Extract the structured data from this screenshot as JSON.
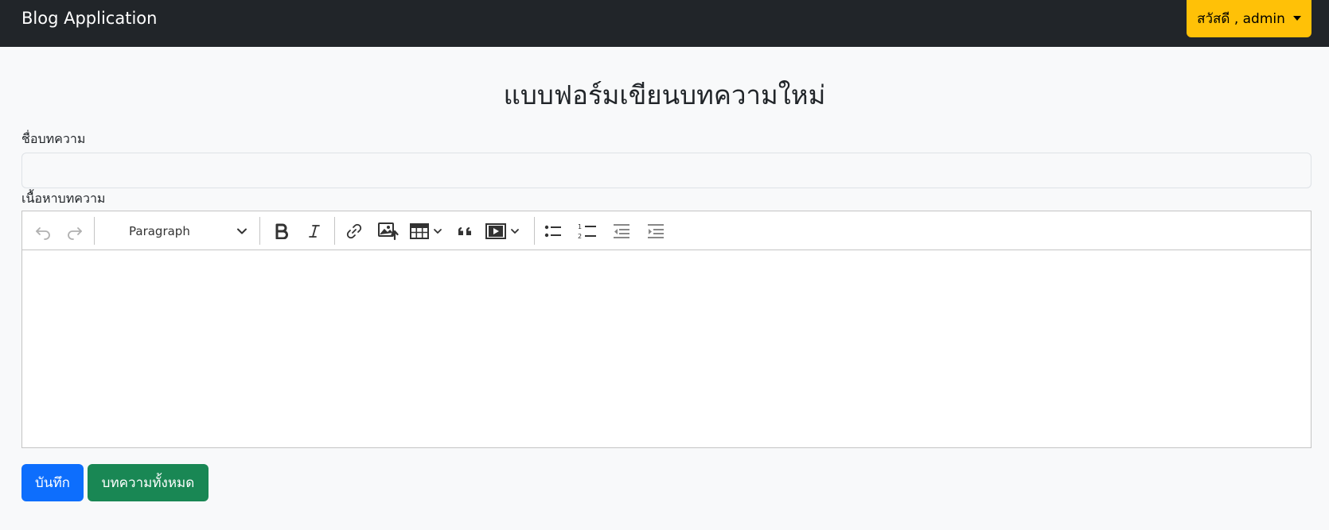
{
  "navbar": {
    "brand": "Blog Application",
    "user_menu_label": "สวัสดี , admin"
  },
  "page": {
    "title": "แบบฟอร์มเขียนบทความใหม่"
  },
  "form": {
    "title_label": "ชื่อบทความ",
    "title_value": "",
    "content_label": "เนื้อหาบทความ"
  },
  "editor": {
    "block_format": "Paragraph",
    "toolbar_icons": [
      "undo-icon",
      "redo-icon",
      "bold-icon",
      "italic-icon",
      "link-icon",
      "image-upload-icon",
      "table-icon",
      "blockquote-icon",
      "media-embed-icon",
      "bulleted-list-icon",
      "numbered-list-icon",
      "outdent-icon",
      "indent-icon"
    ],
    "content": ""
  },
  "actions": {
    "save_label": "บันทึก",
    "all_posts_label": "บทความทั้งหมด"
  },
  "colors": {
    "navbar_bg": "#212529",
    "user_button": "#ffc107",
    "save_button": "#0d6efd",
    "all_posts_button": "#198754"
  }
}
